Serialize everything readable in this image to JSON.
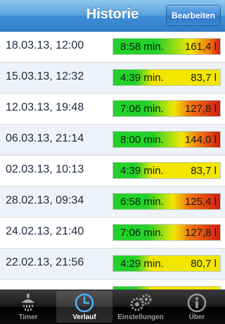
{
  "navbar": {
    "title": "Historie",
    "edit_label": "Bearbeiten"
  },
  "rows": [
    {
      "date": "18.03.13, 12:00",
      "duration": "8:58 min.",
      "volume": "161,4 l",
      "level": 1.0
    },
    {
      "date": "15.03.13, 12:32",
      "duration": "4:39 min.",
      "volume": "83,7 l",
      "level": 0.52
    },
    {
      "date": "12.03.13, 19:48",
      "duration": "7:06 min.",
      "volume": "127,8 l",
      "level": 0.79
    },
    {
      "date": "06.03.13, 21:14",
      "duration": "8:00 min.",
      "volume": "144,0 l",
      "level": 0.89
    },
    {
      "date": "02.03.13, 10:13",
      "duration": "4:39 min.",
      "volume": "83,7 l",
      "level": 0.52
    },
    {
      "date": "28.02.13, 09:34",
      "duration": "6:58 min.",
      "volume": "125,4 l",
      "level": 0.78
    },
    {
      "date": "24.02.13, 21:40",
      "duration": "7:06 min.",
      "volume": "127,8 l",
      "level": 0.79
    },
    {
      "date": "22.02.13, 21:56",
      "duration": "4:29 min.",
      "volume": "80,7 l",
      "level": 0.5
    },
    {
      "date": "",
      "duration": "",
      "volume": "",
      "level": 0.5
    }
  ],
  "tabs": [
    {
      "label": "Timer",
      "icon": "shower-icon",
      "active": false
    },
    {
      "label": "Verlauf",
      "icon": "clock-icon",
      "active": true
    },
    {
      "label": "Einstellungen",
      "icon": "gears-icon",
      "active": false
    },
    {
      "label": "Über",
      "icon": "info-icon",
      "active": false
    }
  ],
  "colors": {
    "nav_blue": "#3f8ed6",
    "gauge_green": "#22d12a",
    "gauge_yellow": "#f2e600",
    "gauge_red": "#d31b12"
  }
}
